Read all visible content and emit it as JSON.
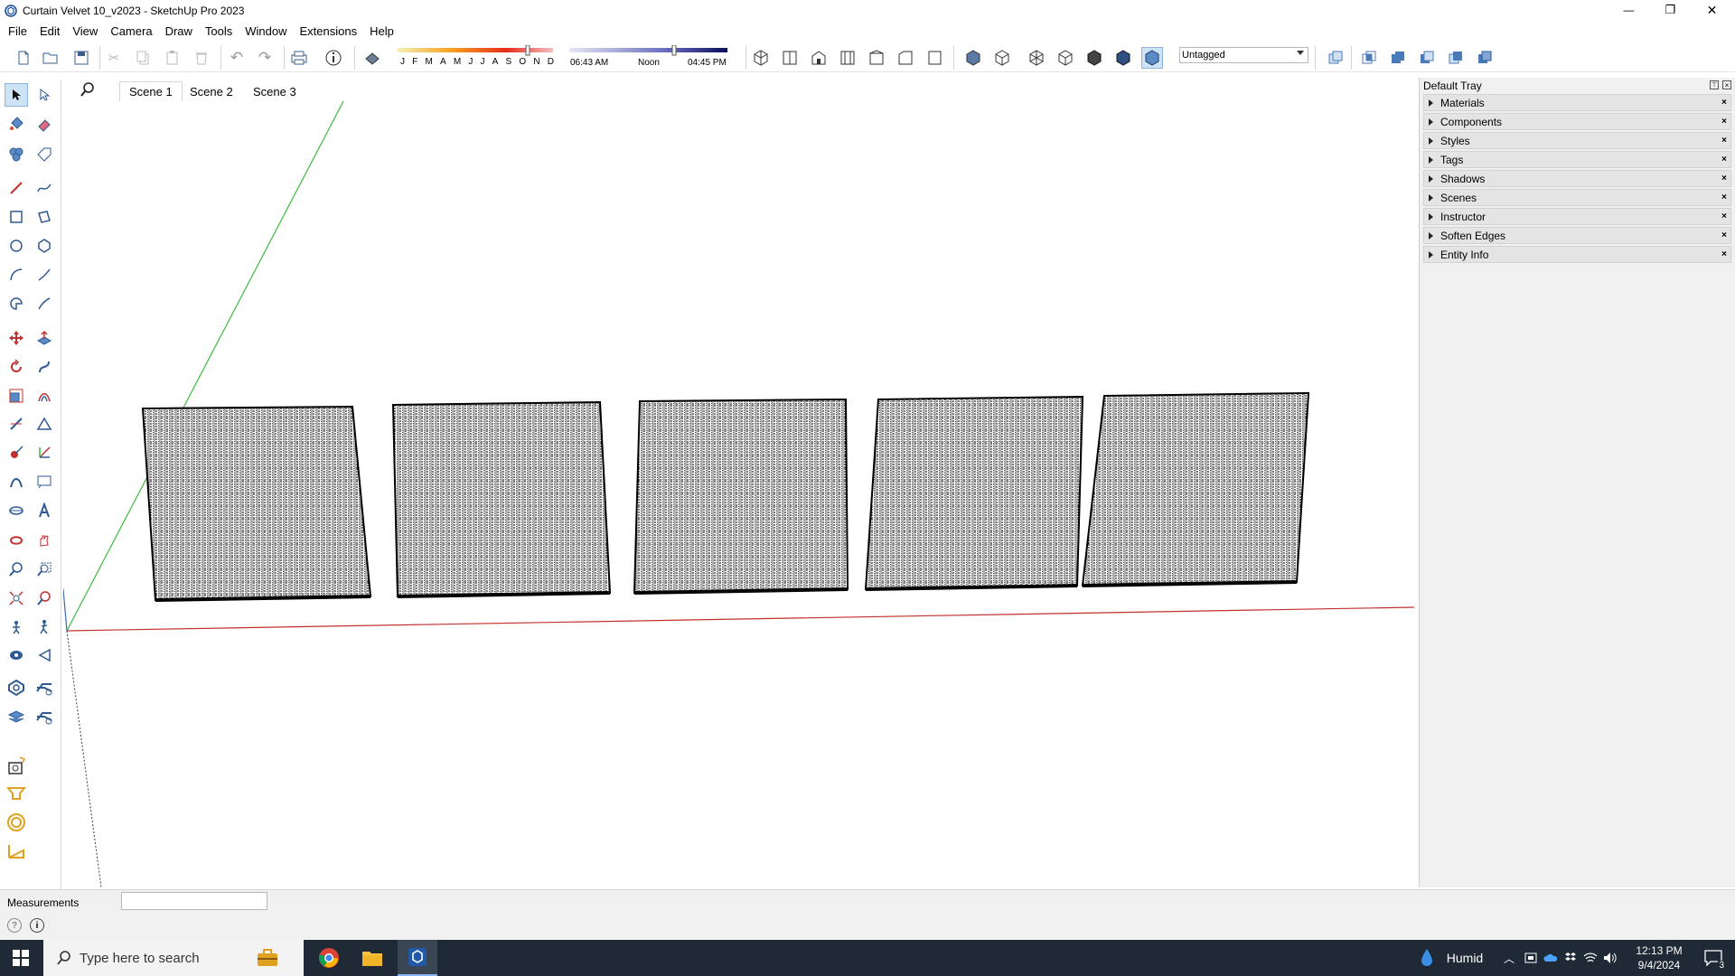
{
  "window": {
    "title": "Curtain Velvet 10_v2023 - SketchUp Pro 2023",
    "minimize": "—",
    "restore": "❐",
    "close": "✕"
  },
  "menu": [
    "File",
    "Edit",
    "View",
    "Camera",
    "Draw",
    "Tools",
    "Window",
    "Extensions",
    "Help"
  ],
  "toolbar": {
    "months": [
      "J",
      "F",
      "M",
      "A",
      "M",
      "J",
      "J",
      "A",
      "S",
      "O",
      "N",
      "D"
    ],
    "time_start": "06:43 AM",
    "time_mid": "Noon",
    "time_end": "04:45 PM",
    "tag_select": "Untagged"
  },
  "scenes": [
    "Scene 1",
    "Scene 2",
    "Scene 3"
  ],
  "active_scene": "Scene 1",
  "tray": {
    "title": "Default Tray",
    "panels": [
      "Materials",
      "Components",
      "Styles",
      "Tags",
      "Shadows",
      "Scenes",
      "Instructor",
      "Soften Edges",
      "Entity Info"
    ]
  },
  "status": {
    "measurements_label": "Measurements",
    "measurements_value": ""
  },
  "taskbar": {
    "search_placeholder": "Type here to search",
    "weather": "Humid",
    "time": "12:13 PM",
    "date": "9/4/2024",
    "notification_count": "3"
  },
  "colors": {
    "axis_green": "#3fb93f",
    "axis_red": "#c0302e",
    "axis_blue_dotted": "#3c3c3c",
    "curtain": "#111111",
    "taskbar": "#1f2a36"
  }
}
